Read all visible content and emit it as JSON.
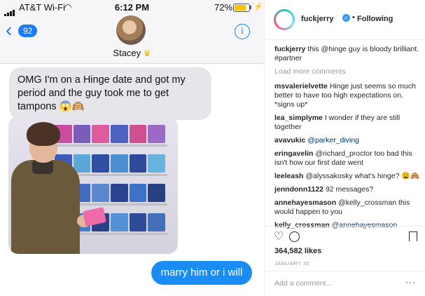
{
  "status_bar": {
    "carrier": "AT&T Wi-Fi",
    "time": "6:12 PM",
    "battery": "72%",
    "battery_level": 0.72
  },
  "messages_header": {
    "back_count": "92",
    "contact_name": "Stacey",
    "icons": [
      "chevron-left-icon",
      "info-icon",
      "crown-emoji"
    ]
  },
  "conversation": {
    "incoming_text": "OMG I'm on a Hinge date and got my period and the guy took me to get tampons 😱🙉",
    "outgoing_text": "marry him or i will"
  },
  "instagram": {
    "username": "fuckjerry",
    "follow_state": "Following",
    "caption": {
      "user": "fuckjerry",
      "text": "this @hinge guy is bloody brilliant. #partner"
    },
    "load_more": "Load more comments",
    "comments": [
      {
        "user": "msvalerielvette",
        "text": "Hinge just seems so much better to have too high expectations on. *signs up*"
      },
      {
        "user": "lea_simplyme",
        "text": "I wonder if they are still together"
      },
      {
        "user": "avavukic",
        "text": "@parker_diving"
      },
      {
        "user": "eringavelin",
        "text": "@richard_proctor too bad this isn't how our first date went"
      },
      {
        "user": "leeleash",
        "text": "@alyssakosky what's hinge? 😩🙈"
      },
      {
        "user": "jenndonn1122",
        "text": "92 messages?"
      },
      {
        "user": "annehayesmason",
        "text": "@kelly_crossman this would happen to you"
      },
      {
        "user": "kelly_crossman",
        "text": "@annehayesmason"
      }
    ],
    "likes": "364,582 likes",
    "date": "JANUARY 30",
    "add_comment_placeholder": "Add a comment...",
    "more_label": "···",
    "colors": {
      "link": "#003569",
      "muted": "#999999",
      "imessage_blue": "#1a8df5"
    }
  }
}
